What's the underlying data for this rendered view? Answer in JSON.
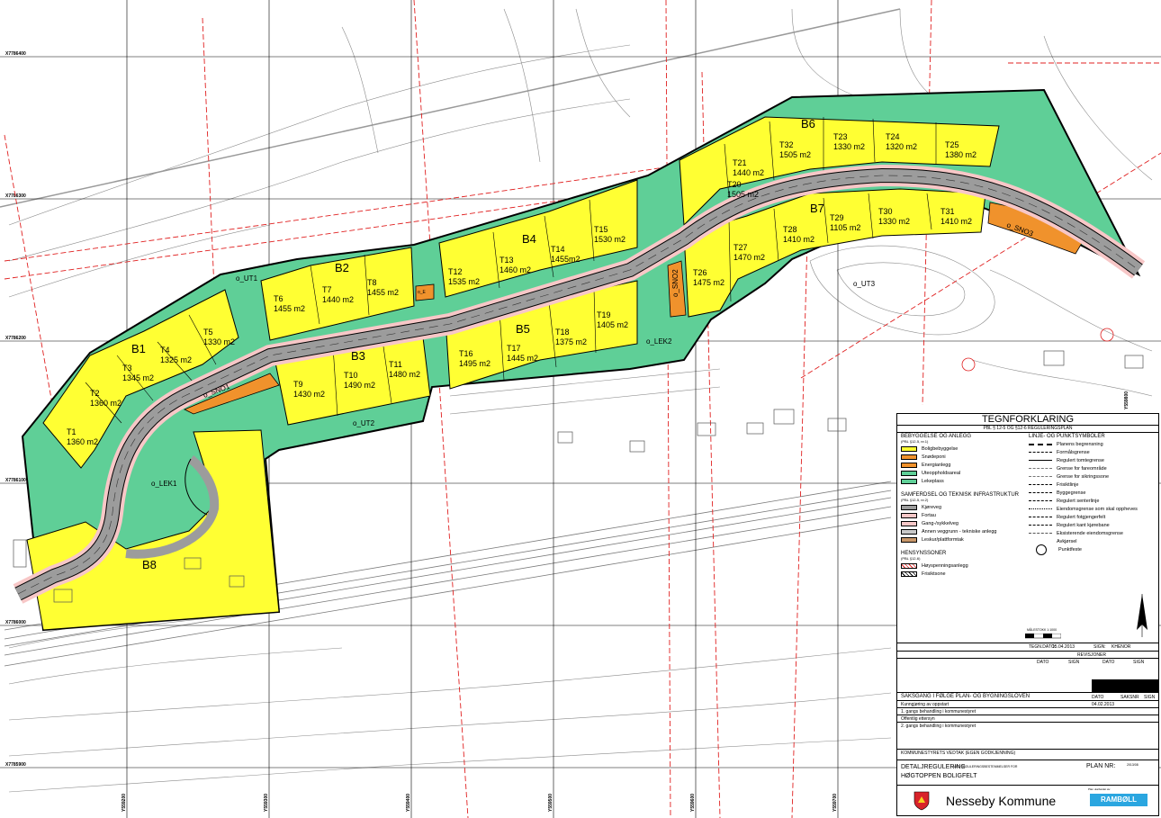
{
  "coords": {
    "x": [
      "X7786400",
      "X7786300",
      "X7786200",
      "X7786100",
      "X7786000",
      "X7785900"
    ],
    "y": [
      "Y559200",
      "Y559300",
      "Y559400",
      "Y559500",
      "Y559600",
      "Y559700",
      "Y559800"
    ]
  },
  "blocks": [
    {
      "id": "B1",
      "label": "B1"
    },
    {
      "id": "B2",
      "label": "B2"
    },
    {
      "id": "B3",
      "label": "B3"
    },
    {
      "id": "B4",
      "label": "B4"
    },
    {
      "id": "B5",
      "label": "B5"
    },
    {
      "id": "B6",
      "label": "B6"
    },
    {
      "id": "B7",
      "label": "B7"
    },
    {
      "id": "B8",
      "label": "B8"
    }
  ],
  "plots": [
    {
      "name": "T1",
      "area": "1360 m2"
    },
    {
      "name": "T2",
      "area": "1360 m2"
    },
    {
      "name": "T3",
      "area": "1345 m2"
    },
    {
      "name": "T4",
      "area": "1325 m2"
    },
    {
      "name": "T5",
      "area": "1330 m2"
    },
    {
      "name": "T6",
      "area": "1455 m2"
    },
    {
      "name": "T7",
      "area": "1440 m2"
    },
    {
      "name": "T8",
      "area": "1455 m2"
    },
    {
      "name": "T9",
      "area": "1430 m2"
    },
    {
      "name": "T10",
      "area": "1490 m2"
    },
    {
      "name": "T11",
      "area": "1480 m2"
    },
    {
      "name": "T12",
      "area": "1535 m2"
    },
    {
      "name": "T13",
      "area": "1460 m2"
    },
    {
      "name": "T14",
      "area": "1455m2"
    },
    {
      "name": "T15",
      "area": "1530 m2"
    },
    {
      "name": "T16",
      "area": "1495 m2"
    },
    {
      "name": "T17",
      "area": "1445 m2"
    },
    {
      "name": "T18",
      "area": "1375 m2"
    },
    {
      "name": "T19",
      "area": "1405 m2"
    },
    {
      "name": "T20",
      "area": "1505 m2"
    },
    {
      "name": "T21",
      "area": "1440 m2"
    },
    {
      "name": "T32",
      "area": "1505 m2"
    },
    {
      "name": "T23",
      "area": "1330 m2"
    },
    {
      "name": "T24",
      "area": "1320 m2"
    },
    {
      "name": "T25",
      "area": "1380 m2"
    },
    {
      "name": "T26",
      "area": "1475 m2"
    },
    {
      "name": "T27",
      "area": "1470 m2"
    },
    {
      "name": "T28",
      "area": "1410 m2"
    },
    {
      "name": "T29",
      "area": "1105 m2"
    },
    {
      "name": "T30",
      "area": "1330 m2"
    },
    {
      "name": "T31",
      "area": "1410 m2"
    }
  ],
  "zones": {
    "ut1": "o_UT1",
    "ut2": "o_UT2",
    "ut3": "o_UT3",
    "lek1": "o_LEK1",
    "lek2": "o_LEK2",
    "sno1": "o_SNO1",
    "sno2": "o_SNO2",
    "sno3": "o_SNO3",
    "e": "o_E"
  },
  "legend": {
    "title": "TEGNFORKLARING",
    "subtitle": "PBL § 12-5 OG §12-6 REGULERINGSPLAN",
    "sec1": "BEBYGGELSE OG ANLEGG",
    "sec1_sub": "(PBL §12-5, nr.1)",
    "sec2": "SAMFERDSEL OG TEKNISK INFRASTRUKTUR",
    "sec2_sub": "(PBL §12-5, nr.2)",
    "sec3": "HENSYNSSONER",
    "sec3_sub": "(PBL §12-6)",
    "sec4": "LINJE- OG PUNKTSYMBOLER",
    "landuse": [
      {
        "label": "Boligbebyggelse",
        "color": "#ffff33"
      },
      {
        "label": "Snødeponi",
        "color": "#f0922c"
      },
      {
        "label": "Energianlegg",
        "color": "#f0922c"
      },
      {
        "label": "Uteoppholdsareal",
        "color": "#5fcf97"
      },
      {
        "label": "Lekeplass",
        "color": "#5fcf97"
      }
    ],
    "transport": [
      {
        "label": "Kjøreveg",
        "color": "#9c9c9c"
      },
      {
        "label": "Fortau",
        "color": "#f7c7c7"
      },
      {
        "label": "Gang-/sykkelveg",
        "color": "#f7c7c7"
      },
      {
        "label": "Annen veggrunn - tekniske anlegg",
        "color": "#c8c8c8"
      },
      {
        "label": "Leskur/plattformtak",
        "color": "#c8976a"
      }
    ],
    "zones": [
      {
        "label": "Høyspenningsanlegg"
      },
      {
        "label": "Frisiktsone"
      }
    ],
    "lines": [
      "Planens begrensning",
      "Formålsgrense",
      "Regulert tomtegrense",
      "Grense for fareområde",
      "Grense for sikringssone",
      "Frisiktlinje",
      "Byggegrense",
      "Regulert senterlinje",
      "Eiendomsgrense som skal oppheves",
      "Regulert fotgjengerfelt",
      "Regulert kant kjørebane",
      "Eksisterende eiendomsgrense",
      "Avkjørsel",
      "Punktfeste"
    ],
    "scale_label": "MÅLESTOKK 1:1000",
    "date_row": {
      "label": "TEGN.DATO:",
      "date": "15.04.2013",
      "sign": "SIGN:",
      "signer": "KHENOR"
    },
    "revisions": {
      "title": "REVISJONER",
      "cols": [
        "DATO",
        "SIGN",
        "DATO",
        "SIGN"
      ]
    },
    "process": {
      "title": "SAKSGANG I FØLGE PLAN- OG BYGNINGSLOVEN",
      "cols": [
        "DATO",
        "SAKSNR",
        "SIGN"
      ],
      "rows": [
        {
          "label": "Kunngjøring av oppstart",
          "date": "04.02.2013"
        },
        {
          "label": "1. gangs behandling i kommunestyret",
          "date": ""
        },
        {
          "label": "Offentlig ettersyn",
          "date": ""
        },
        {
          "label": "2. gangs behandling i kommunestyret",
          "date": ""
        }
      ]
    },
    "approval": "KOMMUNESTYRETS VEDTAK (EGEN GODKJENNING)",
    "plan_type": "DETALJREGULERING",
    "plan_type_sub": "MED REGULERINGSBESTEMMELSER FOR",
    "plan_name": "HØGTOPPEN BOLIGFELT",
    "plan_nr_label": "PLAN NR:",
    "plan_nr": "2013/08",
    "municipality": "Nesseby Kommune",
    "consultant_label": "Plan utarbeidet av:",
    "consultant": "RAMBØLL"
  },
  "colors": {
    "residential": "#ffff33",
    "green": "#5fcf97",
    "orange": "#f0922c",
    "road": "#9c9c9c",
    "sidewalk": "#f7c7c7",
    "boundary": "#000000",
    "powerline": "#e02020",
    "contour": "#8a8a8a"
  }
}
